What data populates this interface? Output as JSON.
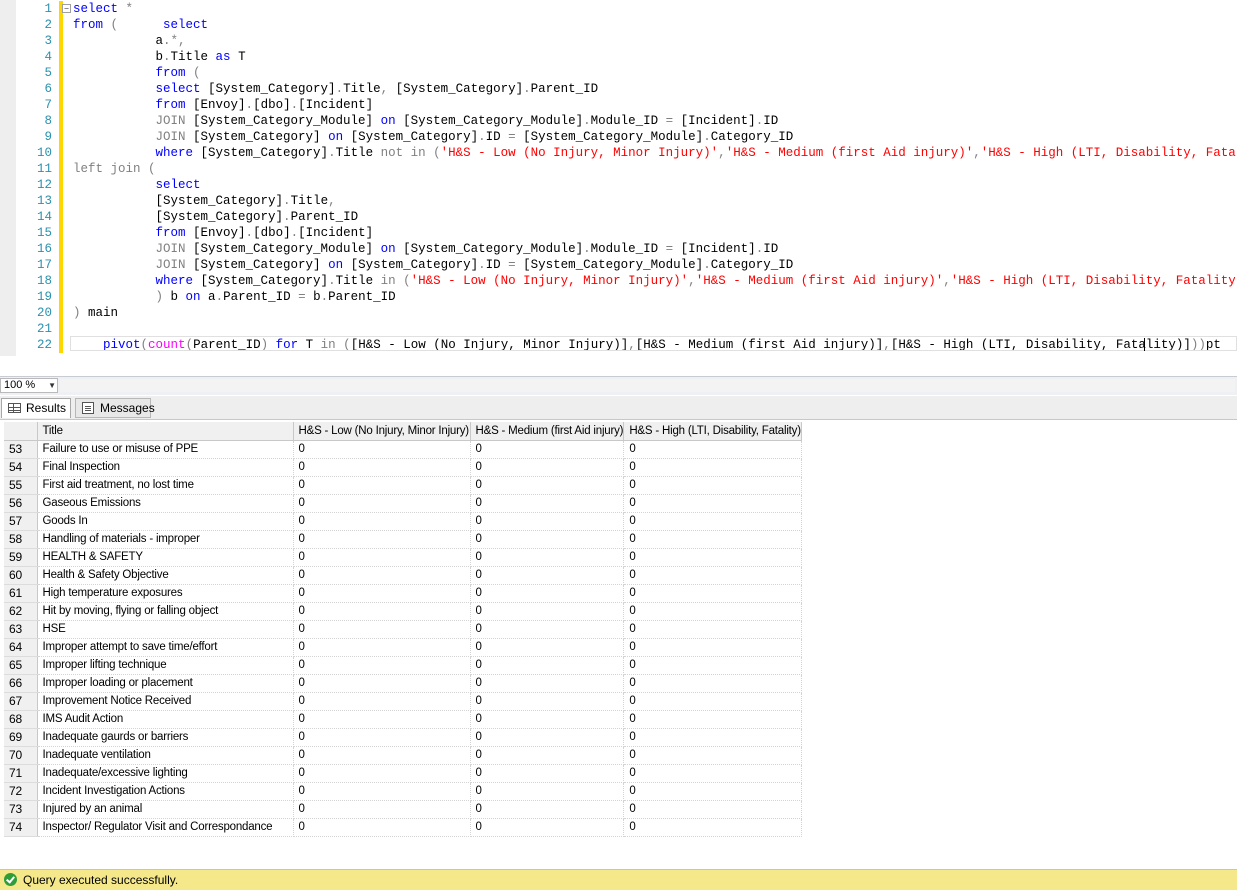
{
  "editor": {
    "lines": [
      {
        "n": "1",
        "fold": "−",
        "tokens": [
          [
            "kw",
            "select"
          ],
          [
            "gr",
            " *"
          ]
        ]
      },
      {
        "n": "2",
        "tokens": [
          [
            "kw",
            "from"
          ],
          [
            "gr",
            " (      "
          ],
          [
            "kw",
            "select"
          ]
        ]
      },
      {
        "n": "3",
        "tokens": [
          [
            "",
            "           a"
          ],
          [
            "gr",
            ".*,"
          ]
        ]
      },
      {
        "n": "4",
        "tokens": [
          [
            "",
            "           b"
          ],
          [
            "gr",
            "."
          ],
          [
            "",
            "Title "
          ],
          [
            "kw",
            "as"
          ],
          [
            "",
            " T"
          ]
        ]
      },
      {
        "n": "5",
        "tokens": [
          [
            "",
            "           "
          ],
          [
            "kw",
            "from"
          ],
          [
            "gr",
            " ("
          ]
        ]
      },
      {
        "n": "6",
        "tokens": [
          [
            "",
            "           "
          ],
          [
            "kw",
            "select"
          ],
          [
            "",
            " [System_Category]"
          ],
          [
            "gr",
            "."
          ],
          [
            "",
            "Title"
          ],
          [
            "gr",
            ","
          ],
          [
            "",
            " [System_Category]"
          ],
          [
            "gr",
            "."
          ],
          [
            "",
            "Parent_ID"
          ]
        ]
      },
      {
        "n": "7",
        "tokens": [
          [
            "",
            "           "
          ],
          [
            "kw",
            "from"
          ],
          [
            "",
            " [Envoy]"
          ],
          [
            "gr",
            "."
          ],
          [
            "",
            "[dbo]"
          ],
          [
            "gr",
            "."
          ],
          [
            "",
            "[Incident]"
          ]
        ]
      },
      {
        "n": "8",
        "tokens": [
          [
            "",
            "           "
          ],
          [
            "gr",
            "JOIN"
          ],
          [
            "",
            " [System_Category_Module] "
          ],
          [
            "kw",
            "on"
          ],
          [
            "",
            " [System_Category_Module]"
          ],
          [
            "gr",
            "."
          ],
          [
            "",
            "Module_ID "
          ],
          [
            "gr",
            "="
          ],
          [
            "",
            " [Incident]"
          ],
          [
            "gr",
            "."
          ],
          [
            "",
            "ID"
          ]
        ]
      },
      {
        "n": "9",
        "tokens": [
          [
            "",
            "           "
          ],
          [
            "gr",
            "JOIN"
          ],
          [
            "",
            " [System_Category] "
          ],
          [
            "kw",
            "on"
          ],
          [
            "",
            " [System_Category]"
          ],
          [
            "gr",
            "."
          ],
          [
            "",
            "ID "
          ],
          [
            "gr",
            "="
          ],
          [
            "",
            " [System_Category_Module]"
          ],
          [
            "gr",
            "."
          ],
          [
            "",
            "Category_ID"
          ]
        ]
      },
      {
        "n": "10",
        "tokens": [
          [
            "",
            "           "
          ],
          [
            "kw",
            "where"
          ],
          [
            "",
            " [System_Category]"
          ],
          [
            "gr",
            "."
          ],
          [
            "",
            "Title "
          ],
          [
            "gr",
            "not in"
          ],
          [
            "gr",
            " ("
          ],
          [
            "st",
            "'H&S - Low (No Injury, Minor Injury)'"
          ],
          [
            "gr",
            ","
          ],
          [
            "st",
            "'H&S - Medium (first Aid injury)'"
          ],
          [
            "gr",
            ","
          ],
          [
            "st",
            "'H&S - High (LTI, Disability, Fatality)'"
          ],
          [
            "gr",
            "))"
          ],
          [
            "",
            "a"
          ]
        ]
      },
      {
        "n": "11",
        "tokens": [
          [
            "gr",
            "left join"
          ],
          [
            "gr",
            " ("
          ]
        ]
      },
      {
        "n": "12",
        "tokens": [
          [
            "",
            "           "
          ],
          [
            "kw",
            "select"
          ]
        ]
      },
      {
        "n": "13",
        "tokens": [
          [
            "",
            "           [System_Category]"
          ],
          [
            "gr",
            "."
          ],
          [
            "",
            "Title"
          ],
          [
            "gr",
            ","
          ]
        ]
      },
      {
        "n": "14",
        "tokens": [
          [
            "",
            "           [System_Category]"
          ],
          [
            "gr",
            "."
          ],
          [
            "",
            "Parent_ID"
          ]
        ]
      },
      {
        "n": "15",
        "tokens": [
          [
            "",
            "           "
          ],
          [
            "kw",
            "from"
          ],
          [
            "",
            " [Envoy]"
          ],
          [
            "gr",
            "."
          ],
          [
            "",
            "[dbo]"
          ],
          [
            "gr",
            "."
          ],
          [
            "",
            "[Incident]"
          ]
        ]
      },
      {
        "n": "16",
        "tokens": [
          [
            "",
            "           "
          ],
          [
            "gr",
            "JOIN"
          ],
          [
            "",
            " [System_Category_Module] "
          ],
          [
            "kw",
            "on"
          ],
          [
            "",
            " [System_Category_Module]"
          ],
          [
            "gr",
            "."
          ],
          [
            "",
            "Module_ID "
          ],
          [
            "gr",
            "="
          ],
          [
            "",
            " [Incident]"
          ],
          [
            "gr",
            "."
          ],
          [
            "",
            "ID"
          ]
        ]
      },
      {
        "n": "17",
        "tokens": [
          [
            "",
            "           "
          ],
          [
            "gr",
            "JOIN"
          ],
          [
            "",
            " [System_Category] "
          ],
          [
            "kw",
            "on"
          ],
          [
            "",
            " [System_Category]"
          ],
          [
            "gr",
            "."
          ],
          [
            "",
            "ID "
          ],
          [
            "gr",
            "="
          ],
          [
            "",
            " [System_Category_Module]"
          ],
          [
            "gr",
            "."
          ],
          [
            "",
            "Category_ID"
          ]
        ]
      },
      {
        "n": "18",
        "tokens": [
          [
            "",
            "           "
          ],
          [
            "kw",
            "where"
          ],
          [
            "",
            " [System_Category]"
          ],
          [
            "gr",
            "."
          ],
          [
            "",
            "Title "
          ],
          [
            "gr",
            "in"
          ],
          [
            "gr",
            " ("
          ],
          [
            "st",
            "'H&S - Low (No Injury, Minor Injury)'"
          ],
          [
            "gr",
            ","
          ],
          [
            "st",
            "'H&S - Medium (first Aid injury)'"
          ],
          [
            "gr",
            ","
          ],
          [
            "st",
            "'H&S - High (LTI, Disability, Fatality)'"
          ],
          [
            "gr",
            ")"
          ]
        ]
      },
      {
        "n": "19",
        "tokens": [
          [
            "gr",
            "           )"
          ],
          [
            "",
            " b "
          ],
          [
            "kw",
            "on"
          ],
          [
            "",
            " a"
          ],
          [
            "gr",
            "."
          ],
          [
            "",
            "Parent_ID "
          ],
          [
            "gr",
            "="
          ],
          [
            "",
            " b"
          ],
          [
            "gr",
            "."
          ],
          [
            "",
            "Parent_ID"
          ]
        ]
      },
      {
        "n": "20",
        "tokens": [
          [
            "gr",
            ")"
          ],
          [
            "",
            " main"
          ]
        ]
      },
      {
        "n": "21",
        "tokens": []
      },
      {
        "n": "22",
        "tokens": [
          [
            "",
            "    "
          ],
          [
            "kw",
            "pivot"
          ],
          [
            "gr",
            "("
          ],
          [
            "fn",
            "count"
          ],
          [
            "gr",
            "("
          ],
          [
            "",
            "Parent_ID"
          ],
          [
            "gr",
            ")"
          ],
          [
            "",
            " "
          ],
          [
            "kw",
            "for"
          ],
          [
            "",
            " T "
          ],
          [
            "gr",
            "in"
          ],
          [
            "gr",
            " ("
          ],
          [
            "",
            "[H&S - Low (No Injury, Minor Injury)]"
          ],
          [
            "gr",
            ","
          ],
          [
            "",
            "[H&S - Medium (first Aid injury)]"
          ],
          [
            "gr",
            ","
          ],
          [
            "",
            "[H&S - High (LTI, Disability, Fatality)]"
          ],
          [
            "gr",
            "))"
          ],
          [
            "",
            "pt"
          ]
        ]
      }
    ]
  },
  "zoom": {
    "value": "100 %"
  },
  "tabs": {
    "results": "Results",
    "messages": "Messages"
  },
  "grid": {
    "headers": [
      "Title",
      "H&S - Low (No Injury, Minor Injury)",
      "H&S - Medium (first Aid injury)",
      "H&S - High (LTI, Disability, Fatality)"
    ],
    "rows": [
      {
        "n": "53",
        "title": "Failure to use or misuse of PPE",
        "low": "0",
        "med": "0",
        "high": "0"
      },
      {
        "n": "54",
        "title": "Final Inspection",
        "low": "0",
        "med": "0",
        "high": "0"
      },
      {
        "n": "55",
        "title": "First aid treatment, no lost time",
        "low": "0",
        "med": "0",
        "high": "0"
      },
      {
        "n": "56",
        "title": "Gaseous Emissions",
        "low": "0",
        "med": "0",
        "high": "0"
      },
      {
        "n": "57",
        "title": "Goods In",
        "low": "0",
        "med": "0",
        "high": "0"
      },
      {
        "n": "58",
        "title": "Handling of materials - improper",
        "low": "0",
        "med": "0",
        "high": "0"
      },
      {
        "n": "59",
        "title": "HEALTH & SAFETY",
        "low": "0",
        "med": "0",
        "high": "0"
      },
      {
        "n": "60",
        "title": "Health & Safety Objective",
        "low": "0",
        "med": "0",
        "high": "0"
      },
      {
        "n": "61",
        "title": "High temperature exposures",
        "low": "0",
        "med": "0",
        "high": "0"
      },
      {
        "n": "62",
        "title": "Hit by moving, flying or falling object",
        "low": "0",
        "med": "0",
        "high": "0"
      },
      {
        "n": "63",
        "title": "HSE",
        "low": "0",
        "med": "0",
        "high": "0"
      },
      {
        "n": "64",
        "title": "Improper attempt to save time/effort",
        "low": "0",
        "med": "0",
        "high": "0"
      },
      {
        "n": "65",
        "title": "Improper lifting technique",
        "low": "0",
        "med": "0",
        "high": "0"
      },
      {
        "n": "66",
        "title": "Improper loading or placement",
        "low": "0",
        "med": "0",
        "high": "0"
      },
      {
        "n": "67",
        "title": "Improvement Notice Received",
        "low": "0",
        "med": "0",
        "high": "0"
      },
      {
        "n": "68",
        "title": "IMS Audit Action",
        "low": "0",
        "med": "0",
        "high": "0"
      },
      {
        "n": "69",
        "title": "Inadequate gaurds or barriers",
        "low": "0",
        "med": "0",
        "high": "0"
      },
      {
        "n": "70",
        "title": "Inadequate ventilation",
        "low": "0",
        "med": "0",
        "high": "0"
      },
      {
        "n": "71",
        "title": "Inadequate/excessive lighting",
        "low": "0",
        "med": "0",
        "high": "0"
      },
      {
        "n": "72",
        "title": "Incident Investigation Actions",
        "low": "0",
        "med": "0",
        "high": "0"
      },
      {
        "n": "73",
        "title": "Injured by an animal",
        "low": "0",
        "med": "0",
        "high": "0"
      },
      {
        "n": "74",
        "title": "Inspector/ Regulator Visit and Correspondance",
        "low": "0",
        "med": "0",
        "high": "0"
      }
    ]
  },
  "status": {
    "text": "Query executed successfully.",
    "icon": "check-circle-icon"
  }
}
